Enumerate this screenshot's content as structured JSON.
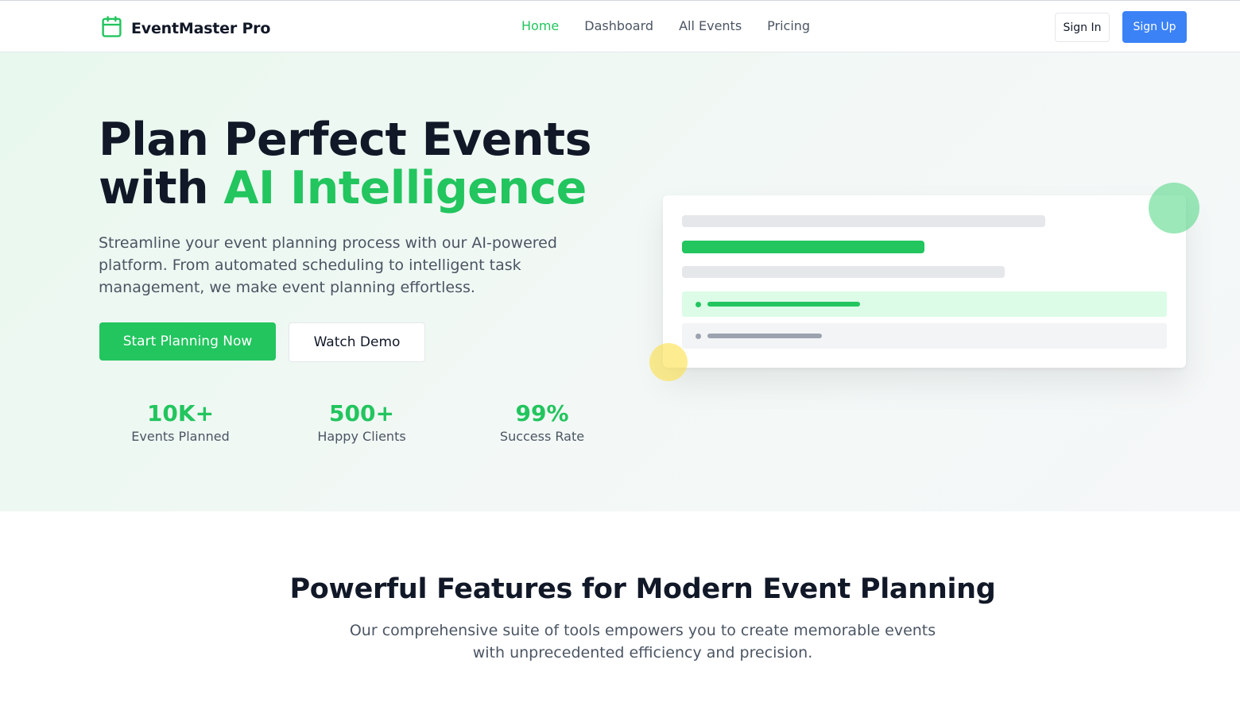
{
  "header": {
    "brand": "EventMaster Pro",
    "brand_icon": "calendar-icon",
    "nav": [
      {
        "label": "Home",
        "active": true
      },
      {
        "label": "Dashboard",
        "active": false
      },
      {
        "label": "All Events",
        "active": false
      },
      {
        "label": "Pricing",
        "active": false
      }
    ],
    "sign_in": "Sign In",
    "sign_up": "Sign Up"
  },
  "hero": {
    "title_line1": "Plan Perfect Events",
    "title_line2_prefix": "with ",
    "title_line2_accent": "AI Intelligence",
    "description": "Streamline your event planning process with our AI-powered platform. From automated scheduling to intelligent task management, we make event planning effortless.",
    "primary_cta": "Start Planning Now",
    "secondary_cta": "Watch Demo",
    "stats": [
      {
        "value": "10K+",
        "label": "Events Planned"
      },
      {
        "value": "500+",
        "label": "Happy Clients"
      },
      {
        "value": "99%",
        "label": "Success Rate"
      }
    ]
  },
  "features": {
    "title": "Powerful Features for Modern Event Planning",
    "description": "Our comprehensive suite of tools empowers you to create memorable events with unprecedented efficiency and precision."
  },
  "colors": {
    "accent": "#22c55e",
    "primary_button": "#3b82f6",
    "text_dark": "#111827",
    "text_muted": "#4b5563"
  }
}
